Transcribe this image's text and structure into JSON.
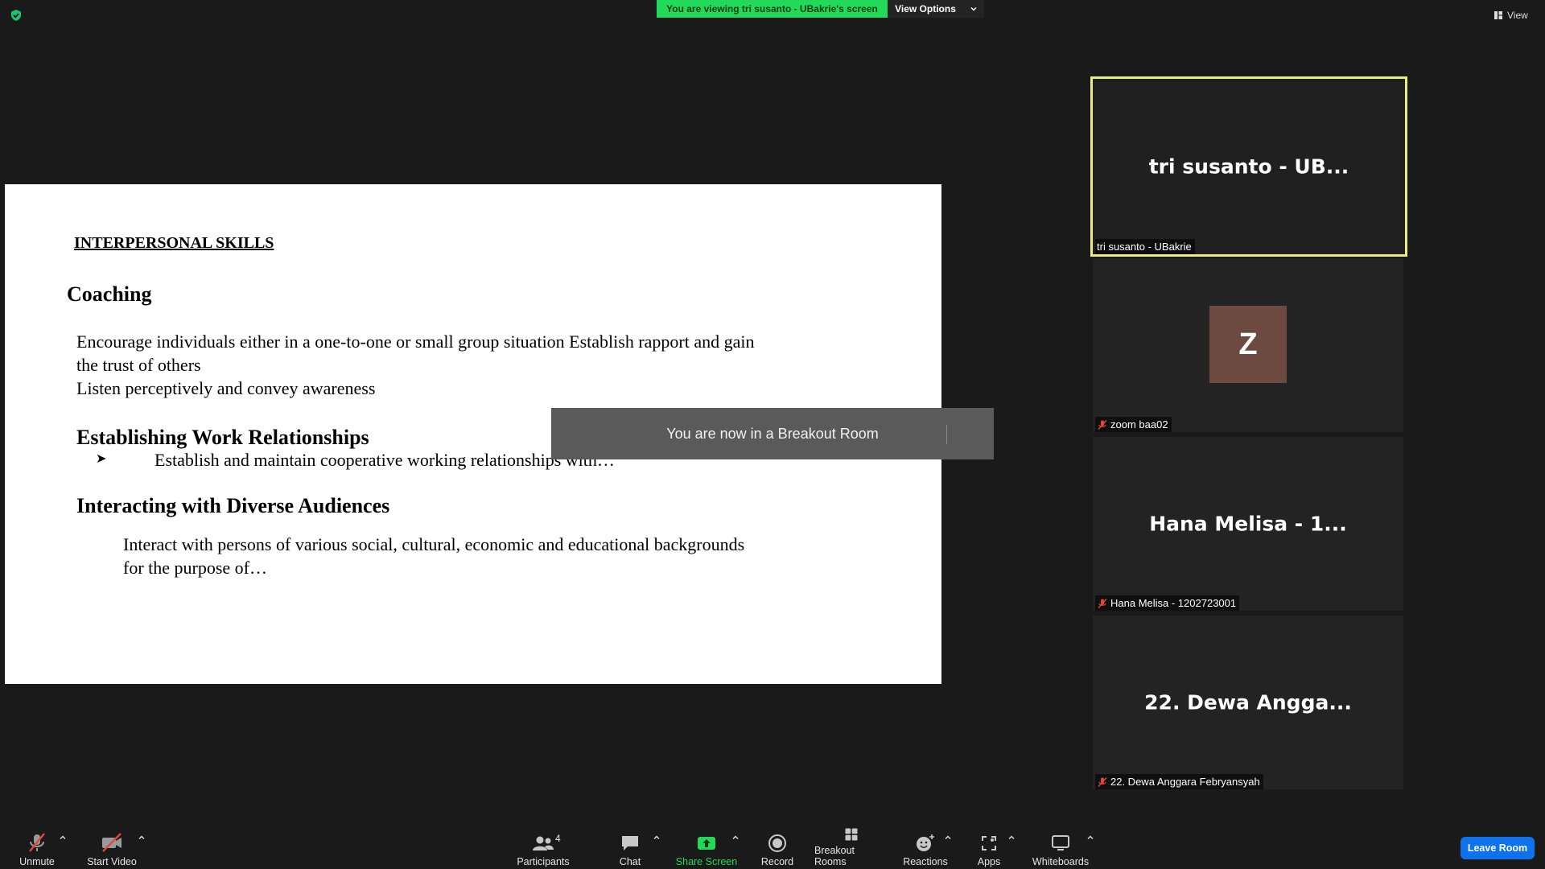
{
  "top_bar": {
    "viewing_banner": "You are viewing tri susanto - UBakrie's screen",
    "view_options_label": "View Options",
    "view_label": "View"
  },
  "slide": {
    "title": "INTERPERSONAL SKILLS",
    "coaching_heading": "Coaching",
    "coaching_lines": [
      "Encourage individuals either in a one-to-one or small group situation Establish rapport and gain",
      "the trust of others",
      "Listen perceptively and convey awareness"
    ],
    "work_heading": "Establishing Work Relationships",
    "work_bullet": "➤",
    "work_line": "Establish and maintain cooperative working relationships with…",
    "diverse_heading": "Interacting with Diverse Audiences",
    "diverse_lines": [
      "Interact with persons of various social, cultural, economic and educational backgrounds",
      "for the purpose of…"
    ]
  },
  "toast": {
    "message": "You are now in a Breakout Room"
  },
  "participants": [
    {
      "display": "tri susanto - UB...",
      "tag": "tri susanto - UBakrie",
      "muted": false,
      "active": true
    },
    {
      "avatar": "Z",
      "tag": "zoom baa02",
      "muted": true,
      "active": false
    },
    {
      "display": "Hana Melisa - 1...",
      "tag": "Hana Melisa - 1202723001",
      "muted": true,
      "active": false
    },
    {
      "display": "22. Dewa Angga...",
      "tag": "22. Dewa Anggara Febryansyah",
      "muted": true,
      "active": false
    }
  ],
  "toolbar": {
    "unmute": "Unmute",
    "start_video": "Start Video",
    "participants": "Participants",
    "participants_count": "4",
    "chat": "Chat",
    "share_screen": "Share Screen",
    "record": "Record",
    "breakout_rooms": "Breakout Rooms",
    "reactions": "Reactions",
    "apps": "Apps",
    "whiteboards": "Whiteboards",
    "leave_room": "Leave Room"
  },
  "colors": {
    "banner_green": "#23d959",
    "active_speaker_border": "#e8ef82",
    "leave_blue": "#0e72ed",
    "muted_red": "#e0473e",
    "share_green": "#23d959"
  }
}
